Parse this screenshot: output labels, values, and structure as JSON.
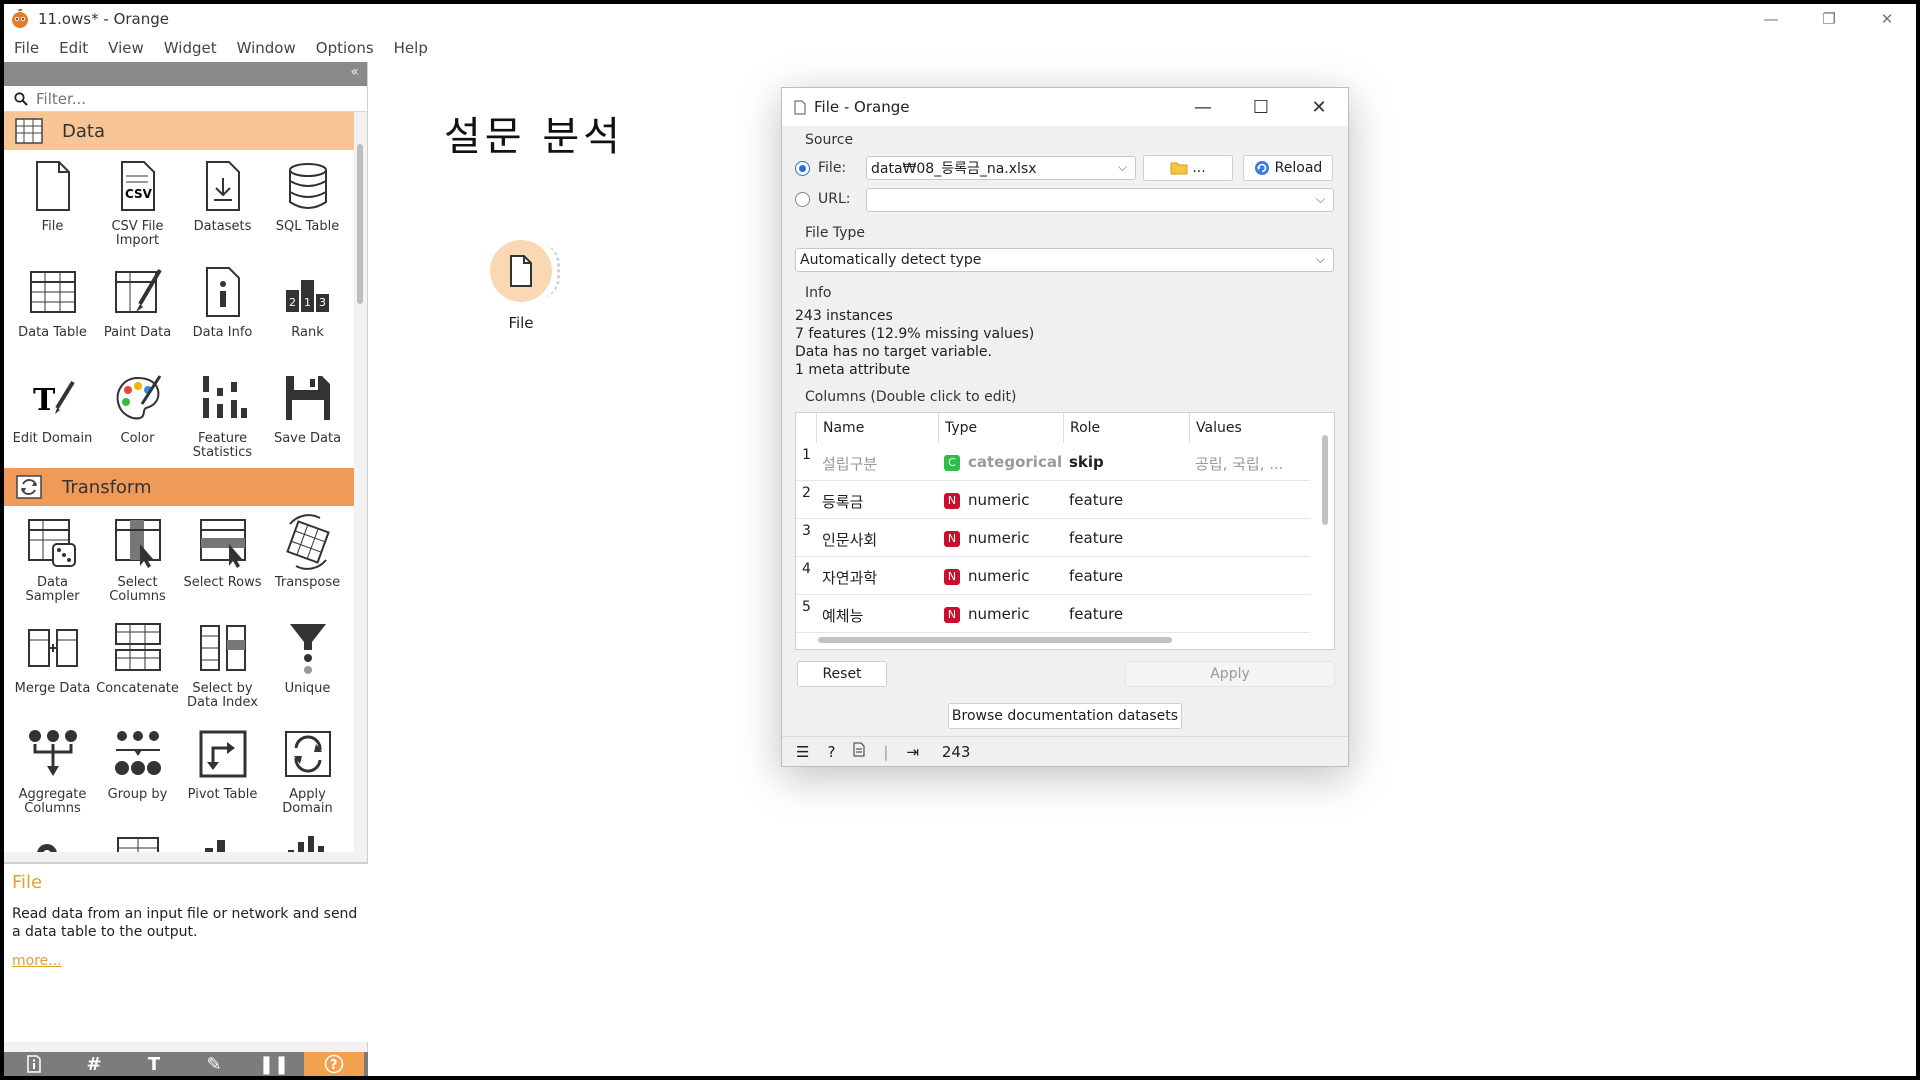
{
  "window": {
    "title": "11.ows* - Orange",
    "controls": [
      "—",
      "❐",
      "✕"
    ]
  },
  "menu": [
    "File",
    "Edit",
    "View",
    "Widget",
    "Window",
    "Options",
    "Help"
  ],
  "toolbox": {
    "collapse_glyph": "«",
    "filter_placeholder": "Filter...",
    "categories": [
      {
        "name": "Data",
        "color": "#f8c696",
        "widgets": [
          {
            "label": "File",
            "icon": "file-icon"
          },
          {
            "label": "CSV File Import",
            "icon": "csv-icon"
          },
          {
            "label": "Datasets",
            "icon": "datasets-icon"
          },
          {
            "label": "SQL Table",
            "icon": "database-icon"
          },
          {
            "label": "Data Table",
            "icon": "table-icon"
          },
          {
            "label": "Paint Data",
            "icon": "paint-icon"
          },
          {
            "label": "Data Info",
            "icon": "info-icon"
          },
          {
            "label": "Rank",
            "icon": "rank-icon"
          },
          {
            "label": "Edit Domain",
            "icon": "edit-domain-icon"
          },
          {
            "label": "Color",
            "icon": "palette-icon"
          },
          {
            "label": "Feature Statistics",
            "icon": "statistics-icon"
          },
          {
            "label": "Save Data",
            "icon": "save-icon"
          }
        ]
      },
      {
        "name": "Transform",
        "color": "#f09a5a",
        "widgets": [
          {
            "label": "Data Sampler",
            "icon": "sampler-icon"
          },
          {
            "label": "Select Columns",
            "icon": "select-columns-icon"
          },
          {
            "label": "Select Rows",
            "icon": "select-rows-icon"
          },
          {
            "label": "Transpose",
            "icon": "transpose-icon"
          },
          {
            "label": "Merge Data",
            "icon": "merge-icon"
          },
          {
            "label": "Concatenate",
            "icon": "concatenate-icon"
          },
          {
            "label": "Select by Data Index",
            "icon": "select-index-icon"
          },
          {
            "label": "Unique",
            "icon": "unique-icon"
          },
          {
            "label": "Aggregate Columns",
            "icon": "aggregate-icon"
          },
          {
            "label": "Group by",
            "icon": "group-by-icon"
          },
          {
            "label": "Pivot Table",
            "icon": "pivot-icon"
          },
          {
            "label": "Apply Domain",
            "icon": "apply-domain-icon"
          }
        ]
      }
    ]
  },
  "help": {
    "title": "File",
    "text": "Read data from an input file or network and send a data table to the output.",
    "more": "more..."
  },
  "bottom_toolbar": [
    "info-icon",
    "grid-icon",
    "text-icon",
    "pen-icon",
    "pause-icon",
    "help-icon"
  ],
  "canvas": {
    "title": "설문 분석",
    "node_label": "File"
  },
  "dialog": {
    "title": "File - Orange",
    "source_label": "Source",
    "file_label": "File:",
    "file_value": "data₩08_등록금_na.xlsx",
    "browse_label": "...",
    "reload_label": "Reload",
    "url_label": "URL:",
    "url_value": "",
    "filetype_label": "File Type",
    "filetype_value": "Automatically detect type",
    "info_label": "Info",
    "info_lines": [
      "243 instances",
      "7 features (12.9% missing values)",
      "Data has no target variable.",
      "1 meta attribute"
    ],
    "columns_label": "Columns (Double click to edit)",
    "columns_headers": [
      "Name",
      "Type",
      "Role",
      "Values"
    ],
    "rows": [
      {
        "num": "1",
        "name": "설립구분",
        "badge": "C",
        "type": "categorical",
        "role": "skip",
        "values": "공립, 국립, ..."
      },
      {
        "num": "2",
        "name": "등록금",
        "badge": "N",
        "type": "numeric",
        "role": "feature",
        "values": ""
      },
      {
        "num": "3",
        "name": "인문사회",
        "badge": "N",
        "type": "numeric",
        "role": "feature",
        "values": ""
      },
      {
        "num": "4",
        "name": "자연과학",
        "badge": "N",
        "type": "numeric",
        "role": "feature",
        "values": ""
      },
      {
        "num": "5",
        "name": "예체능",
        "badge": "N",
        "type": "numeric",
        "role": "feature",
        "values": ""
      }
    ],
    "reset_label": "Reset",
    "apply_label": "Apply",
    "browse_docs_label": "Browse documentation datasets",
    "output_count": "243"
  }
}
